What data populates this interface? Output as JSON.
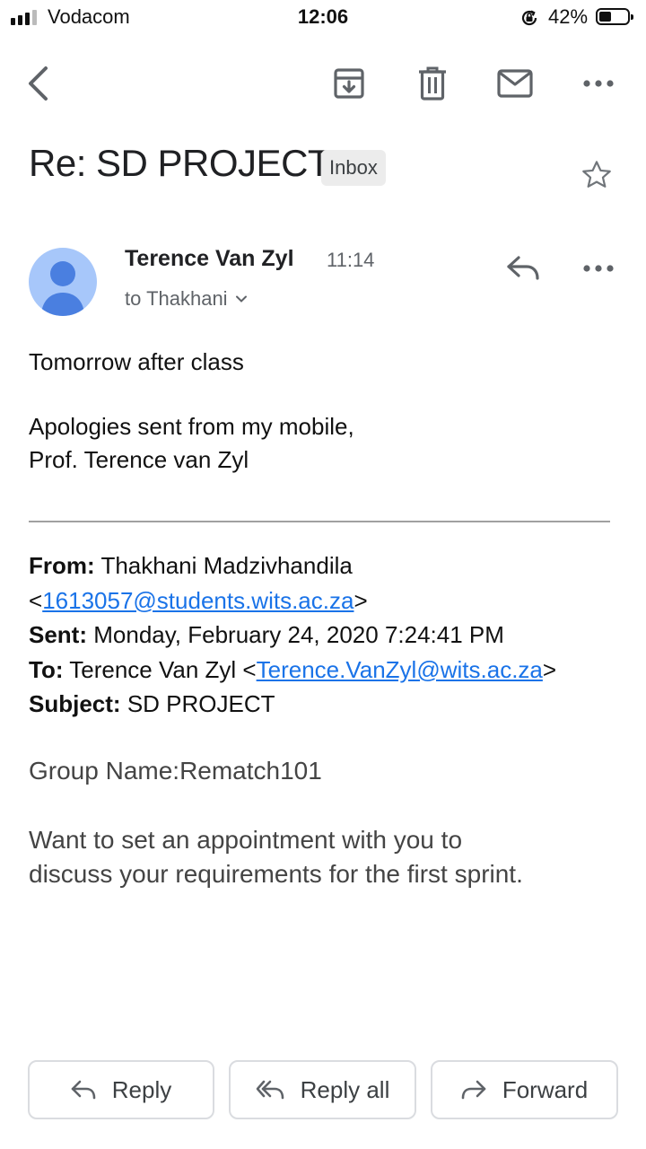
{
  "status_bar": {
    "carrier": "Vodacom",
    "time": "12:06",
    "battery_percent": "42%",
    "battery_level": 0.42
  },
  "toolbar": {
    "icons": [
      "back-arrow-icon",
      "archive-icon",
      "trash-icon",
      "mail-icon",
      "more-horizontal-icon"
    ]
  },
  "email": {
    "subject": "Re: SD PROJECT",
    "label": "Inbox",
    "sender": {
      "name": "Terence Van Zyl",
      "time": "11:14",
      "recipient": "to Thakhani"
    },
    "body": {
      "line1": "Tomorrow after class",
      "signature_line1": "Apologies sent from my mobile,",
      "signature_line2": "Prof. Terence van Zyl"
    },
    "quoted": {
      "from_label": "From:",
      "from_name": "Thakhani Madzivhandila",
      "from_email": "1613057@students.wits.ac.za",
      "sent_label": "Sent:",
      "sent_value": "Monday, February 24, 2020 7:24:41 PM",
      "to_label": "To:",
      "to_name": "Terence Van Zyl",
      "to_email": "Terence.VanZyl@wits.ac.za",
      "subject_label": "Subject:",
      "subject_value": "SD PROJECT",
      "group_name": "Group Name:Rematch101",
      "message_line1": "Want to set an appointment with you to",
      "message_line2": "discuss your requirements for the first sprint."
    }
  },
  "actions": {
    "reply": "Reply",
    "reply_all": "Reply all",
    "forward": "Forward"
  },
  "colors": {
    "link": "#1a73e8",
    "avatar_bg": "#a7c7fa",
    "avatar_fg": "#4a7fe0"
  }
}
